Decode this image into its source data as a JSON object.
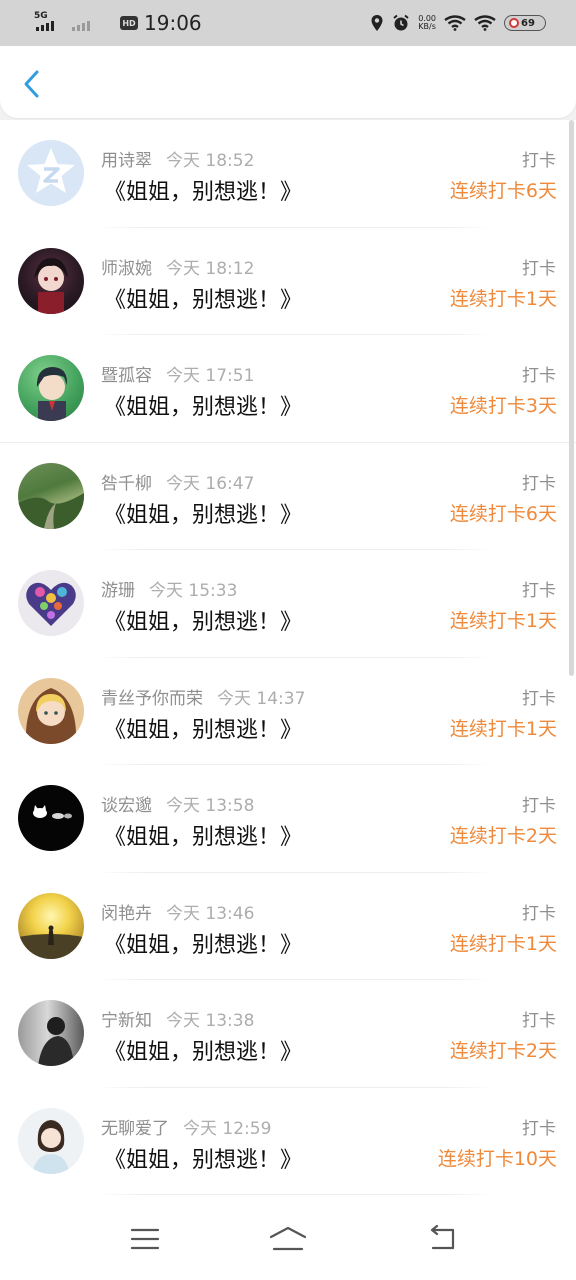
{
  "status_bar": {
    "network": "5G",
    "hd": "HD",
    "time": "19:06",
    "speed_value": "0.00",
    "speed_unit": "KB/s",
    "battery": "69",
    "icons": [
      "signal-icon",
      "hd-icon",
      "location-icon",
      "alarm-icon",
      "wifi-6-icon",
      "wifi-icon",
      "battery-icon"
    ]
  },
  "header": {
    "back_icon": "chevron-left-icon",
    "accent_color": "#2f9ee0"
  },
  "colors": {
    "streak": "#ef8a3c",
    "muted": "#8f8f8f"
  },
  "feed": [
    {
      "name": "用诗翠",
      "time": "今天 18:52",
      "tag": "打卡",
      "title": "《姐姐，别想逃！》",
      "streak": "连续打卡6天",
      "avatar": "default-qq-avatar"
    },
    {
      "name": "师淑婉",
      "time": "今天 18:12",
      "tag": "打卡",
      "title": "《姐姐，别想逃！》",
      "streak": "连续打卡1天",
      "avatar": "anime-dark-avatar"
    },
    {
      "name": "暨孤容",
      "time": "今天 17:51",
      "tag": "打卡",
      "title": "《姐姐，别想逃！》",
      "streak": "连续打卡3天",
      "avatar": "anime-boy-avatar"
    },
    {
      "name": "咎千柳",
      "time": "今天 16:47",
      "tag": "打卡",
      "title": "《姐姐，别想逃！》",
      "streak": "连续打卡6天",
      "avatar": "forest-avatar"
    },
    {
      "name": "游珊",
      "time": "今天 15:33",
      "tag": "打卡",
      "title": "《姐姐，别想逃！》",
      "streak": "连续打卡1天",
      "avatar": "flower-heart-avatar"
    },
    {
      "name": "青丝予你而荣",
      "time": "今天 14:37",
      "tag": "打卡",
      "title": "《姐姐，别想逃！》",
      "streak": "连续打卡1天",
      "avatar": "anime-blonde-avatar"
    },
    {
      "name": "谈宏邈",
      "time": "今天 13:58",
      "tag": "打卡",
      "title": "《姐姐，别想逃！》",
      "streak": "连续打卡2天",
      "avatar": "black-cats-avatar"
    },
    {
      "name": "闵艳卉",
      "time": "今天 13:46",
      "tag": "打卡",
      "title": "《姐姐，别想逃！》",
      "streak": "连续打卡1天",
      "avatar": "sunset-avatar"
    },
    {
      "name": "宁新知",
      "time": "今天 13:38",
      "tag": "打卡",
      "title": "《姐姐，别想逃！》",
      "streak": "连续打卡2天",
      "avatar": "bw-photo-avatar"
    },
    {
      "name": "无聊爱了",
      "time": "今天 12:59",
      "tag": "打卡",
      "title": "《姐姐，别想逃！》",
      "streak": "连续打卡10天",
      "avatar": "girl-photo-avatar"
    }
  ],
  "nav_bar": {
    "icons": [
      "menu-icon",
      "home-icon",
      "back-icon"
    ]
  }
}
